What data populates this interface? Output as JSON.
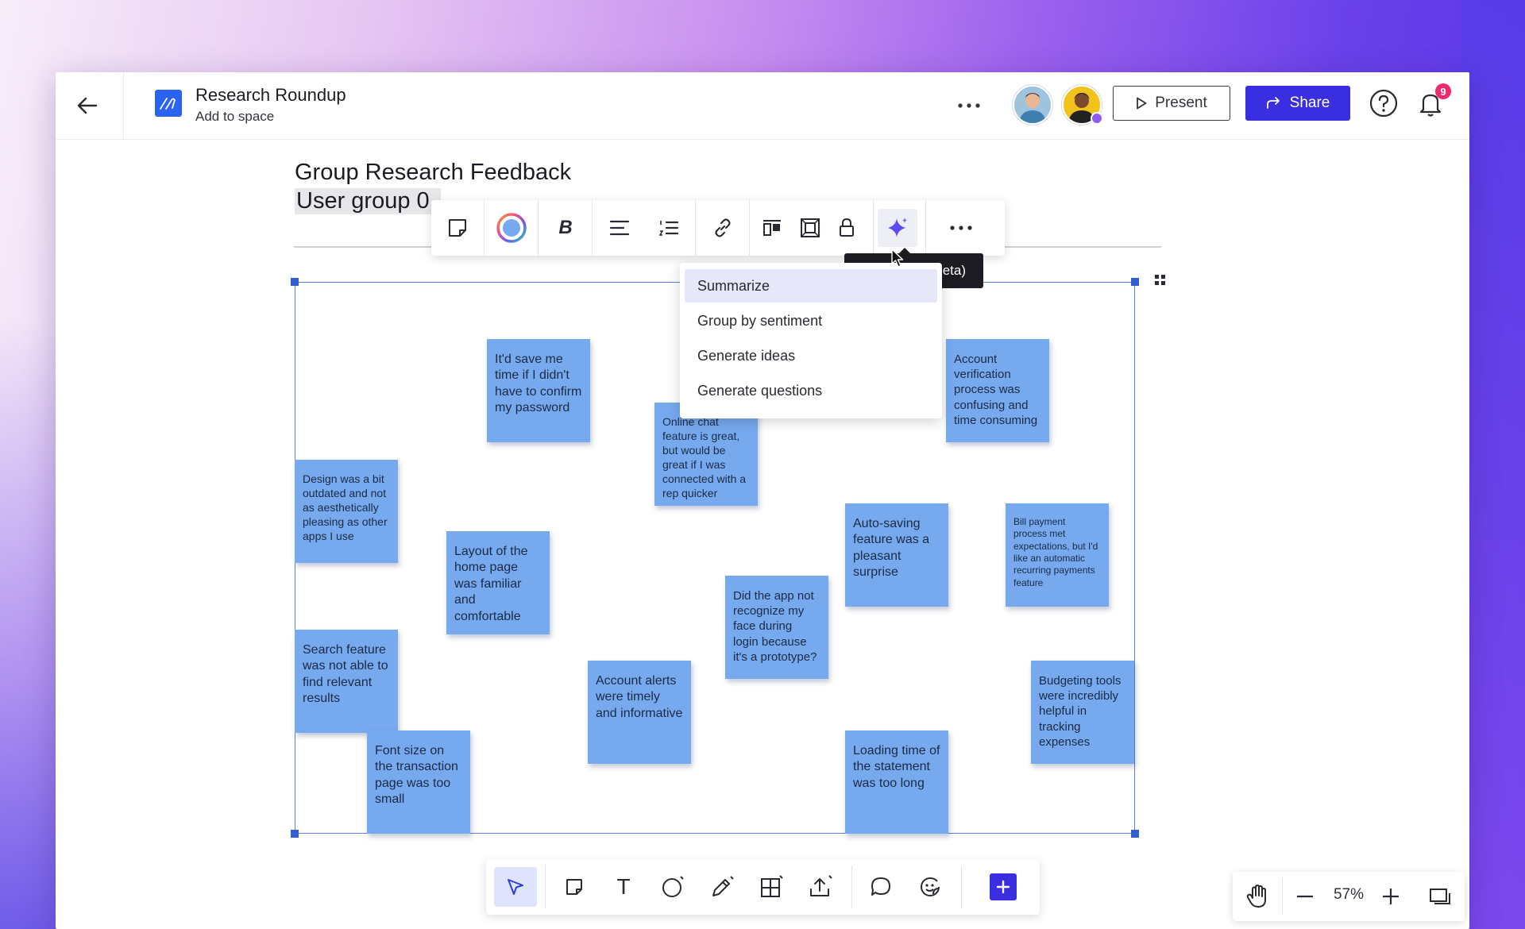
{
  "header": {
    "back_label": "",
    "doc_title": "Research Roundup",
    "doc_subtitle": "Add to space",
    "present_label": "Present",
    "share_label": "Share",
    "notification_count": "9",
    "accent_color": "#3a2fe0",
    "badge_color": "#ee2a6e"
  },
  "board": {
    "title": "Group Research Feedback",
    "subtitle": "User group 0",
    "sticky_color": "#77a9ef"
  },
  "stickies": [
    {
      "text": "It'd save me time if I didn't have to confirm my password"
    },
    {
      "text": "Online chat feature is great, but would be great if I was connected with a rep quicker"
    },
    {
      "text": "Account verification process was confusing and time consuming"
    },
    {
      "text": "Design was a bit outdated and not as aesthetically pleasing as other apps I use"
    },
    {
      "text": "Layout of the home page was familiar and comfortable"
    },
    {
      "text": "Auto-saving feature was a pleasant surprise"
    },
    {
      "text": "Bill payment process met expectations, but I'd like an automatic recurring payments feature"
    },
    {
      "text": "Did the app not recognize my face during login because it's a prototype?"
    },
    {
      "text": "Search feature was not able to find relevant results"
    },
    {
      "text": "Account alerts were timely and informative"
    },
    {
      "text": "Budgeting tools were incredibly helpful in tracking expenses"
    },
    {
      "text": "Font size on the transaction page was too small"
    },
    {
      "text": "Loading time of the statement was too long"
    }
  ],
  "format_toolbar": {
    "tools": [
      "sticky-note-icon",
      "color-icon",
      "bold-icon",
      "align-left-icon",
      "numbered-list-icon",
      "link-icon",
      "arrange-icon",
      "frame-icon",
      "lock-icon",
      "ai-sparkle-icon",
      "more-icon"
    ],
    "bold_glyph": "B"
  },
  "tooltip": {
    "text": "eta)"
  },
  "ai_menu": {
    "items": [
      "Summarize",
      "Group by sentiment",
      "Generate ideas",
      "Generate questions"
    ],
    "selected": "Summarize"
  },
  "bottom_toolbar": {
    "tools": [
      "select-icon",
      "sticky-note-icon",
      "text-icon",
      "shape-icon",
      "pen-icon",
      "table-icon",
      "upload-icon",
      "comment-icon",
      "sticker-icon",
      "add-icon"
    ],
    "text_glyph": "T"
  },
  "zoom": {
    "level": "57%"
  }
}
